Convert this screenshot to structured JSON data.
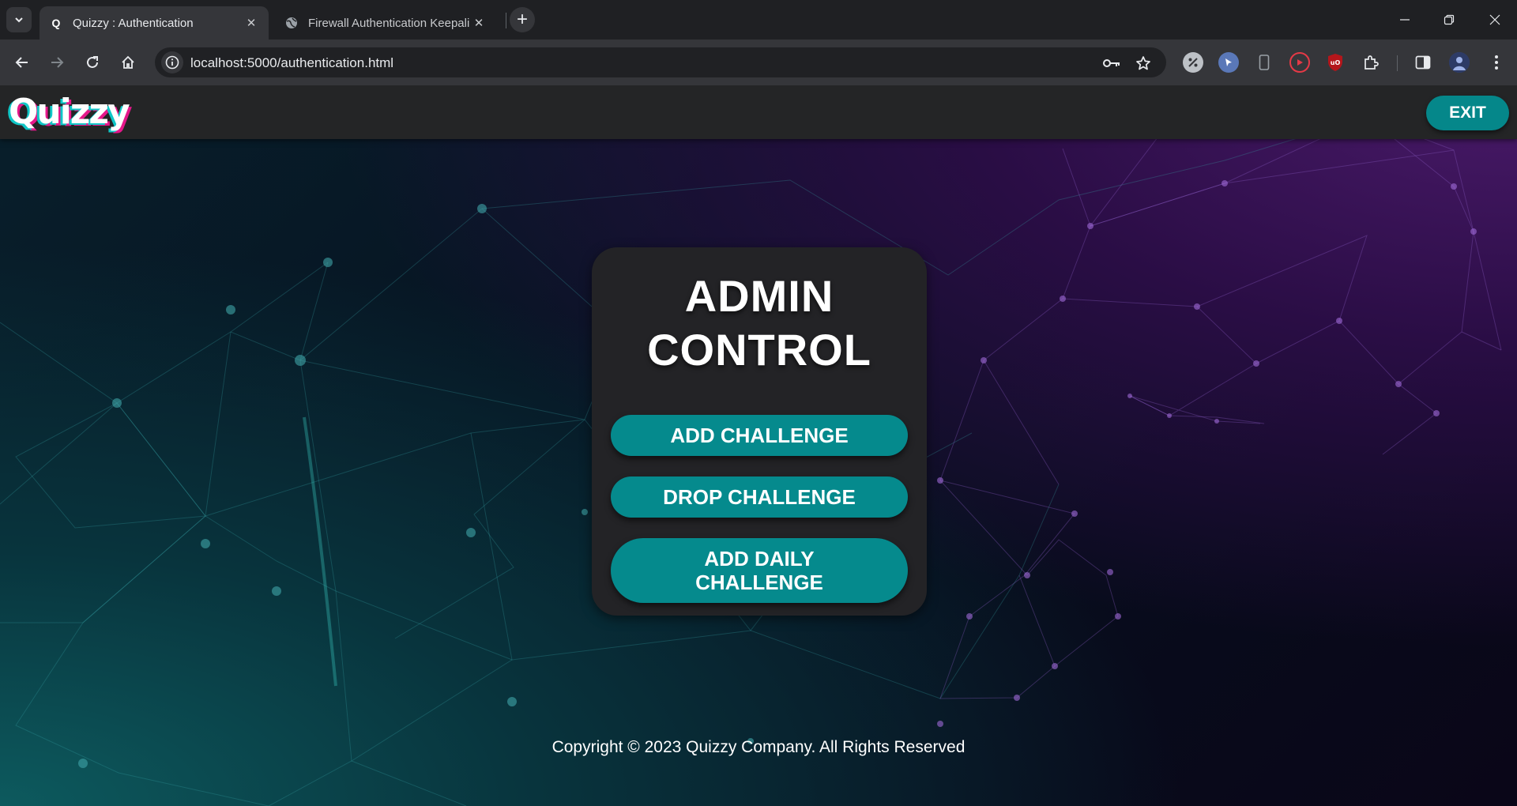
{
  "browser": {
    "tabs": [
      {
        "title": "Quizzy : Authentication",
        "favicon": "Q",
        "active": true
      },
      {
        "title": "Firewall Authentication Keepali",
        "active": false
      }
    ],
    "url": "localhost:5000/authentication.html"
  },
  "app": {
    "logo": "Quizzy",
    "exit_label": "EXIT",
    "card": {
      "title_line1": "ADMIN",
      "title_line2": "CONTROL",
      "buttons": [
        "ADD CHALLENGE",
        "DROP CHALLENGE",
        "ADD DAILY CHALLENGE"
      ]
    },
    "footer": "Copyright © 2023 Quizzy Company. All Rights Reserved"
  },
  "colors": {
    "accent": "#058a8d",
    "card": "#232326",
    "header": "#242526"
  }
}
